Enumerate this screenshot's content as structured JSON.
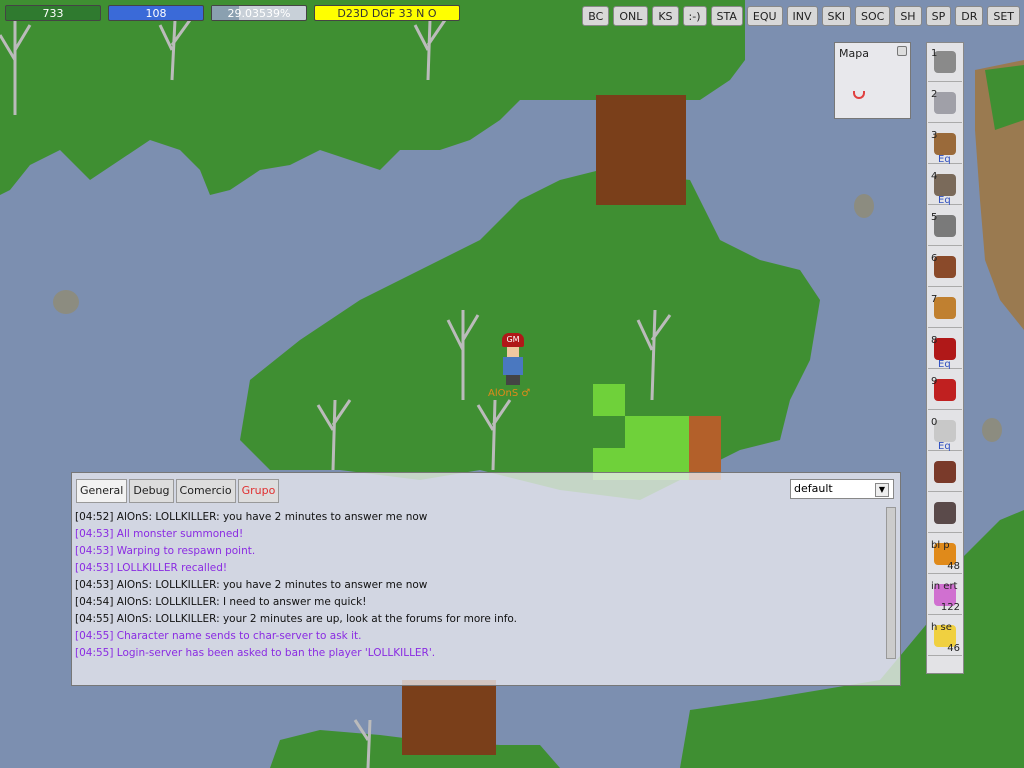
{
  "status": {
    "hp": {
      "label": "733",
      "color": "#2f7a2f"
    },
    "mp": {
      "label": "108",
      "color": "#3a6ad8"
    },
    "xp": {
      "label": "29.03539%",
      "fill": 0.29,
      "color": "#8aa0b0"
    },
    "money": {
      "label": "D23D DGF 33 N O",
      "color": "#ffff00"
    }
  },
  "top_buttons": [
    "BC",
    "ONL",
    "KS",
    ":-)",
    "STA",
    "EQU",
    "INV",
    "SKI",
    "SOC",
    "SH",
    "SP",
    "DR",
    "SET"
  ],
  "minimap": {
    "title": "Mapa"
  },
  "shortcuts": [
    {
      "key": "1",
      "icon": "helmet-icon",
      "eq": ""
    },
    {
      "key": "2",
      "icon": "armor-icon",
      "eq": ""
    },
    {
      "key": "3",
      "icon": "boots-icon",
      "eq": "Eq"
    },
    {
      "key": "4",
      "icon": "gloves-icon",
      "eq": "Eq"
    },
    {
      "key": "5",
      "icon": "shield-icon",
      "eq": ""
    },
    {
      "key": "6",
      "icon": "glove-icon",
      "eq": ""
    },
    {
      "key": "7",
      "icon": "ring-icon",
      "eq": ""
    },
    {
      "key": "8",
      "icon": "gm-hat-icon",
      "eq": "Eq"
    },
    {
      "key": "9",
      "icon": "robe-icon",
      "eq": ""
    },
    {
      "key": "0",
      "icon": "sword-icon",
      "eq": "Eq"
    },
    {
      "key": "",
      "icon": "bow-icon",
      "eq": ""
    },
    {
      "key": "",
      "icon": "wings-icon",
      "eq": ""
    },
    {
      "key": "bl",
      "label": "bl p",
      "icon": "potion-orange-icon",
      "count": "48"
    },
    {
      "key": "in",
      "label": "in ert",
      "icon": "potion-pink-icon",
      "count": "122"
    },
    {
      "key": "h",
      "label": "h se",
      "icon": "beer-icon",
      "count": "46"
    }
  ],
  "chat": {
    "tabs": [
      "General",
      "Debug",
      "Comercio",
      "Grupo"
    ],
    "active_tab": "General",
    "channel": "default",
    "lines": [
      {
        "text": "[04:52] AlOnS: LOLLKILLER: you have 2 minutes to answer me now",
        "color": "#111111"
      },
      {
        "text": "[04:53] All monster summoned!",
        "color": "#8a2be2"
      },
      {
        "text": "[04:53] Warping to respawn point.",
        "color": "#8a2be2"
      },
      {
        "text": "[04:53] LOLLKILLER recalled!",
        "color": "#8a2be2"
      },
      {
        "text": "[04:53] AlOnS: LOLLKILLER: you have 2 minutes to answer me now",
        "color": "#111111"
      },
      {
        "text": "[04:54] AlOnS: LOLLKILLER: I need to answer me quick!",
        "color": "#111111"
      },
      {
        "text": "[04:55] AlOnS: LOLLKILLER: your 2 minutes are up, look at the forums for more info.",
        "color": "#111111"
      },
      {
        "text": "[04:55] Character name sends to char-server to ask it.",
        "color": "#8a2be2"
      },
      {
        "text": "[04:55] Login-server has been asked to ban the player 'LOLLKILLER'.",
        "color": "#8a2be2"
      }
    ]
  },
  "player": {
    "name": "AlOnS ♂",
    "badge": "GM"
  }
}
